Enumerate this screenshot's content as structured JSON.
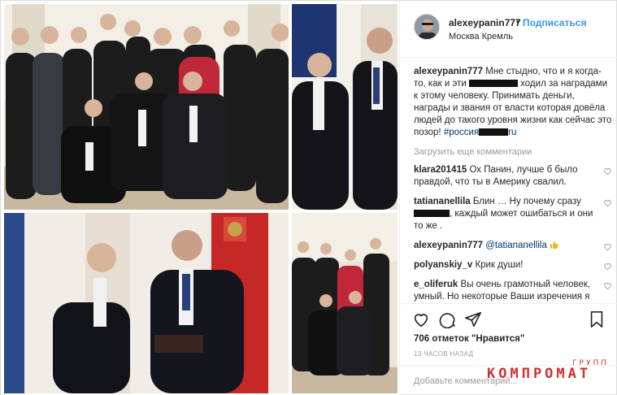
{
  "post": {
    "username": "alexeypanin777",
    "separator": "•",
    "follow_label": "Подписаться",
    "location": "Москва Кремль",
    "caption": {
      "username": "alexeypanin777",
      "part1": "Мне стыдно, что и я когда-то, как и эти",
      "part2": "ходил за наградами к этому человеку. Принимать деньги, награды и звания от власти которая довёла людей до такого уровня жизни как сейчас это позор!",
      "hashtag": "#россия",
      "hashtag_tail": "ru"
    },
    "load_more_label": "Загрузить еще комментарии",
    "comments": [
      {
        "user": "klara201415",
        "text": "Ох Панин, лучше б было правдой, что ты в Америку свалил."
      },
      {
        "user": "tatiananellila",
        "text_before": "Блин … Ну почему сразу",
        "text_after": ", каждый может ошибаться и они то же ."
      },
      {
        "user": "alexeypanin777",
        "text": "@tatiananellila"
      },
      {
        "user": "polyanskiy_v",
        "text": "Крик души!"
      },
      {
        "user": "e_oliferuk",
        "text": "Вы очень грамотный человек, умный. Но некоторые Ваши изречения я считаю напрасны в"
      }
    ],
    "likes": "706 отметок \"Нравится\"",
    "time": "13 ЧАСОВ НАЗАД",
    "add_comment_placeholder": "Добавьте комментарий...",
    "icons": [
      "heart-icon",
      "comment-icon",
      "share-icon",
      "bookmark-icon"
    ]
  },
  "watermark": {
    "top": "ГРУПП",
    "main": "КОМПРОМАТ"
  },
  "colors": {
    "link": "#3897f0",
    "hashtag": "#003569",
    "muted": "#999999",
    "watermark": "#d32f2f"
  }
}
